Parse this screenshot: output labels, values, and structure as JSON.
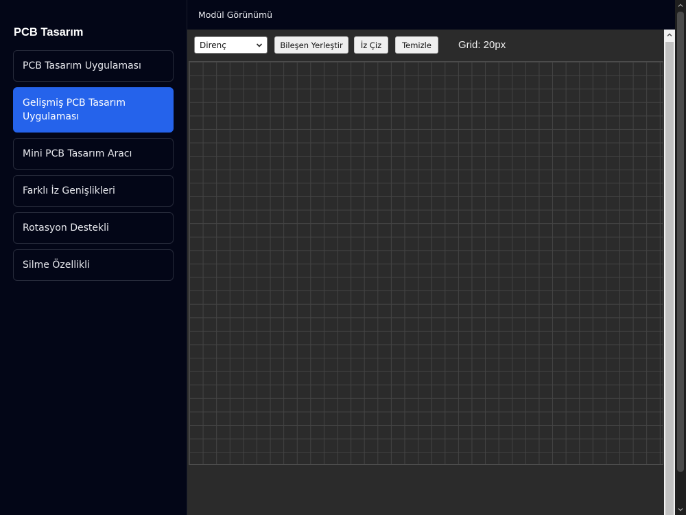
{
  "sidebar": {
    "title": "PCB Tasarım",
    "items": [
      {
        "label": "PCB Tasarım Uygulaması",
        "active": false
      },
      {
        "label": "Gelişmiş PCB Tasarım Uygulaması",
        "active": true
      },
      {
        "label": "Mini PCB Tasarım Aracı",
        "active": false
      },
      {
        "label": "Farklı İz Genişlikleri",
        "active": false
      },
      {
        "label": "Rotasyon Destekli",
        "active": false
      },
      {
        "label": "Silme Özellikli",
        "active": false
      }
    ]
  },
  "main": {
    "header_title": "Modül Görünümü",
    "toolbar": {
      "component_select_value": "Direnç",
      "place_button": "Bileşen Yerleştir",
      "trace_button": "İz Çiz",
      "clear_button": "Temizle",
      "grid_label": "Grid: 20px"
    }
  },
  "colors": {
    "accent": "#2563eb",
    "sidebar_bg": "#030617",
    "canvas_bg": "#2b2b2b",
    "grid_line": "#444444"
  },
  "icons": {
    "select_arrow": "chevron-down-icon",
    "scroll_up": "chevron-up-icon",
    "scroll_down": "chevron-down-icon"
  }
}
